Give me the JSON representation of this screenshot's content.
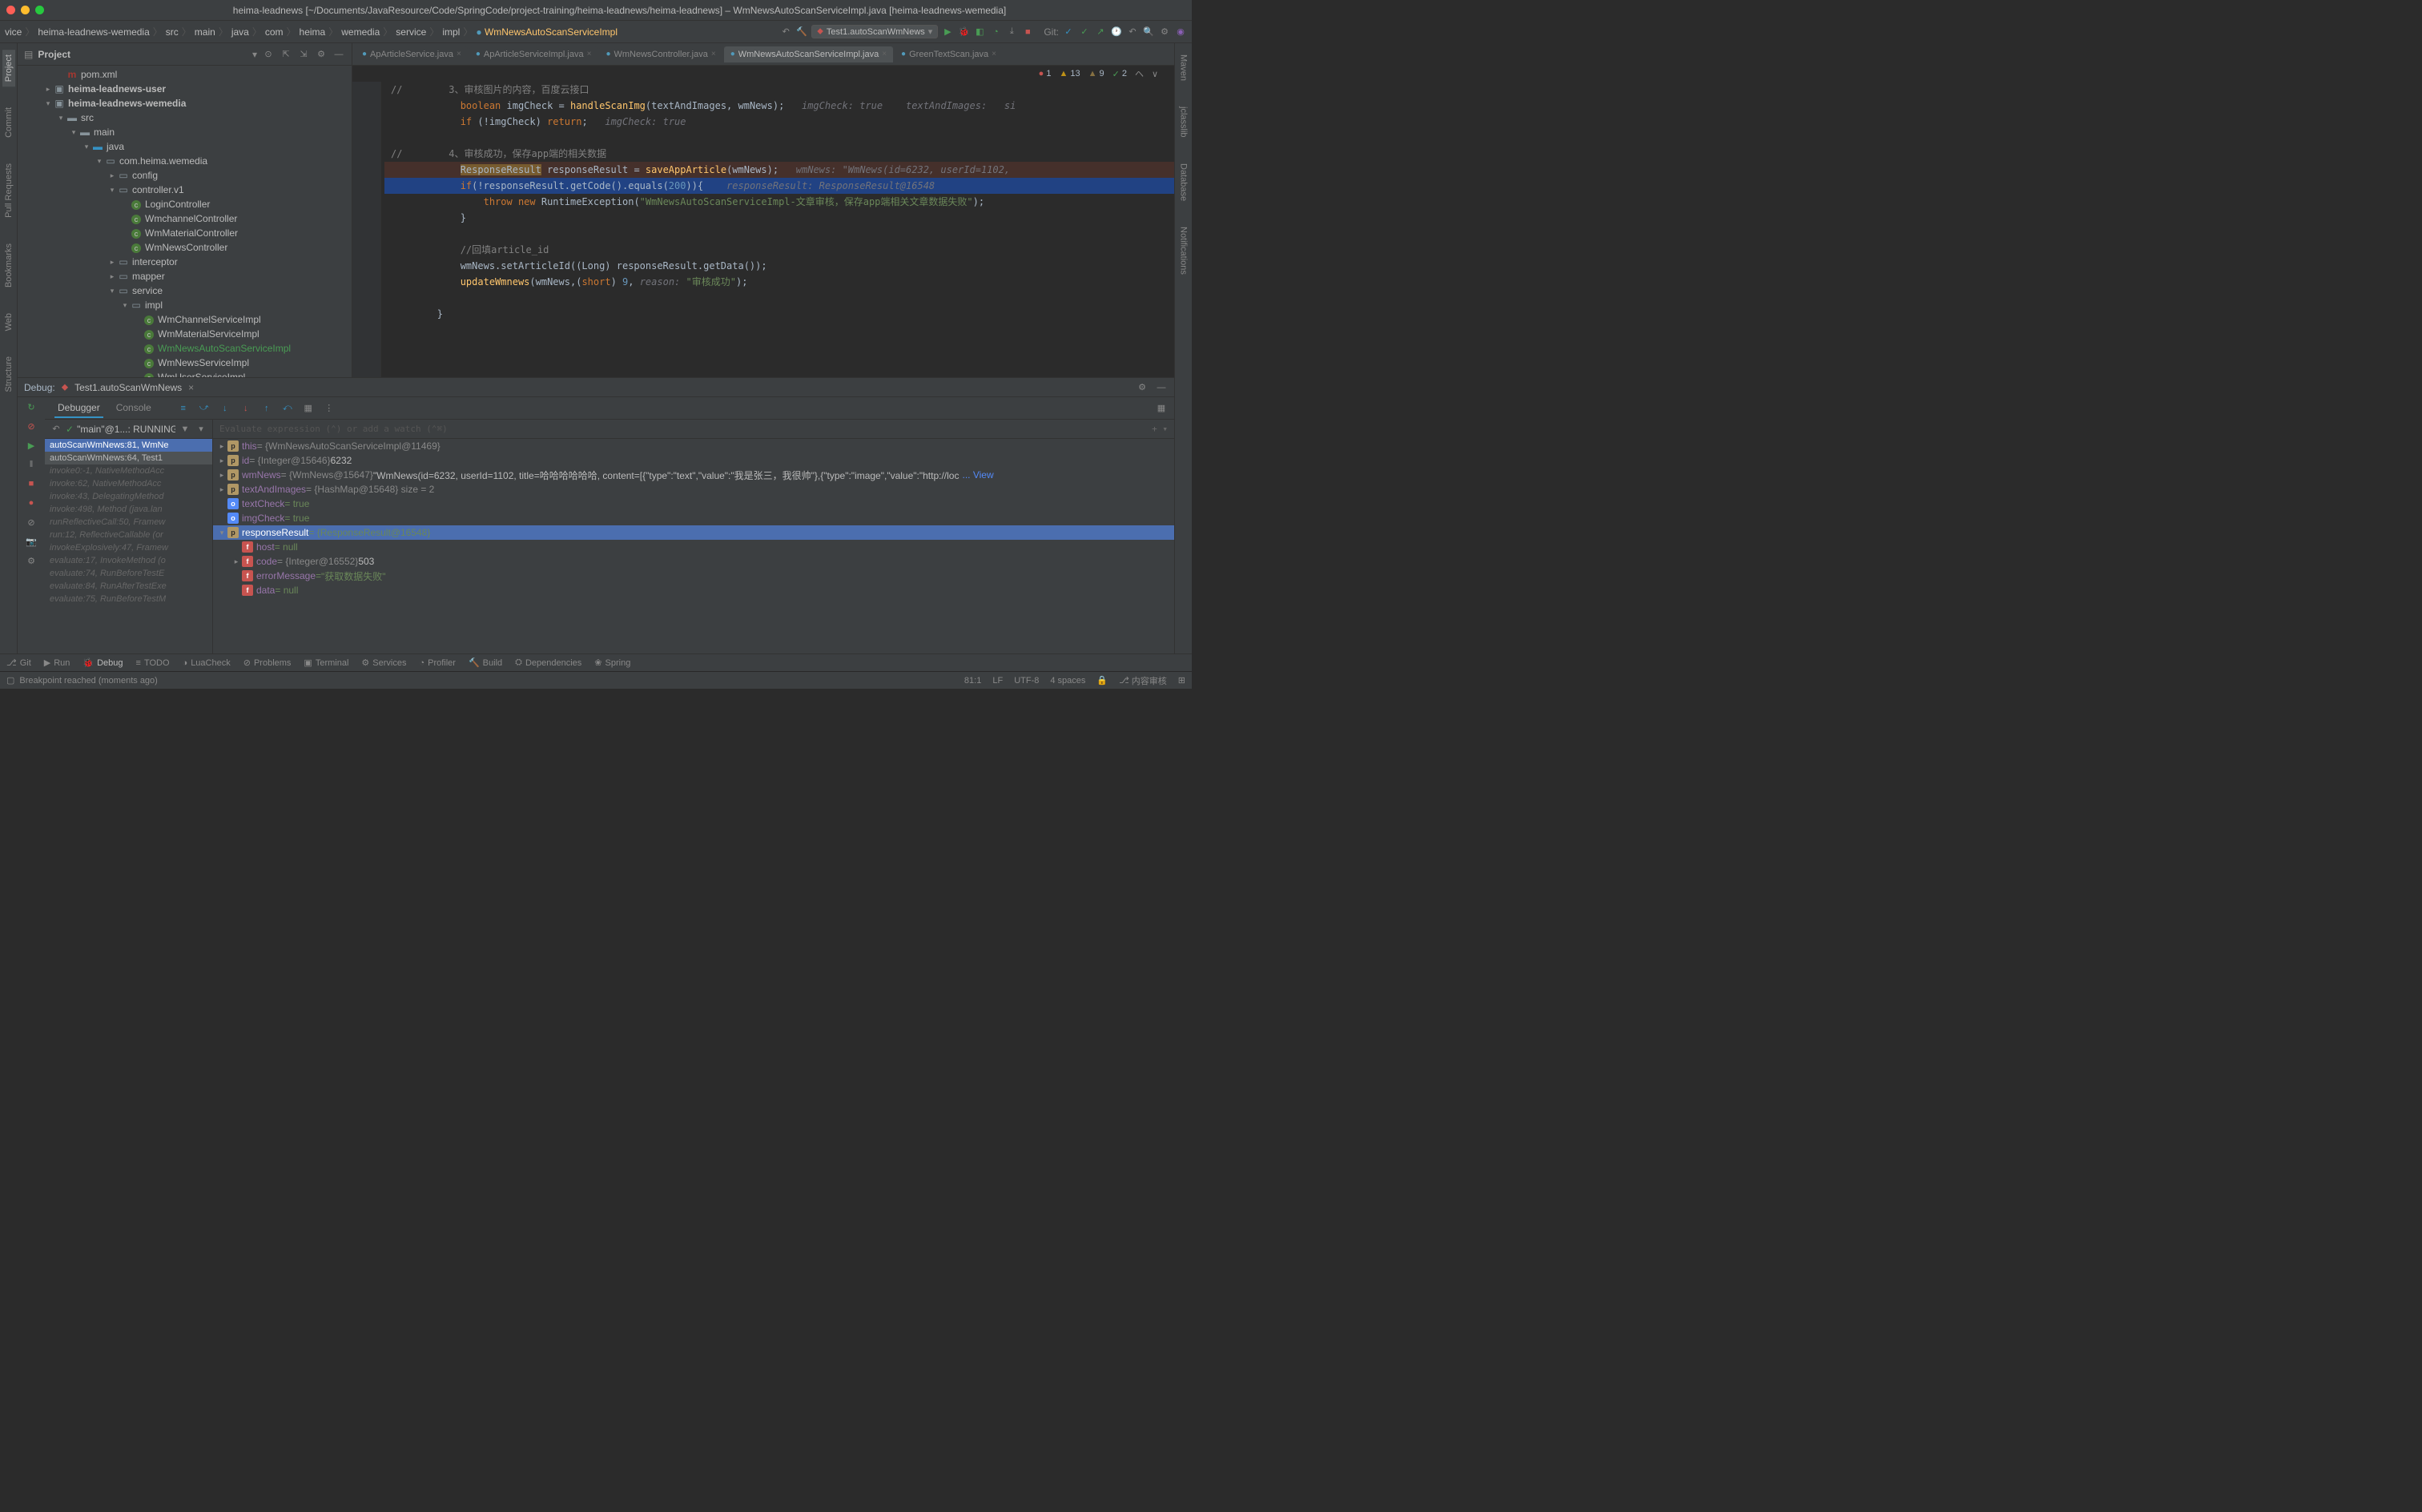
{
  "window": {
    "title": "heima-leadnews [~/Documents/JavaResource/Code/SpringCode/project-training/heima-leadnews/heima-leadnews] – WmNewsAutoScanServiceImpl.java [heima-leadnews-wemedia]"
  },
  "breadcrumb": [
    "vice",
    "heima-leadnews-wemedia",
    "src",
    "main",
    "java",
    "com",
    "heima",
    "wemedia",
    "service",
    "impl",
    "WmNewsAutoScanServiceImpl"
  ],
  "runConfig": "Test1.autoScanWmNews",
  "gitLabel": "Git:",
  "leftTabs": [
    "Project",
    "Commit",
    "Pull Requests",
    "Bookmarks",
    "Web",
    "Structure"
  ],
  "rightTabs": [
    "Maven",
    "jclasslib",
    "Database",
    "Notifications"
  ],
  "projectPanel": {
    "title": "Project"
  },
  "tree": [
    {
      "d": 3,
      "a": "",
      "i": "m",
      "t": "pom.xml"
    },
    {
      "d": 2,
      "a": ">",
      "i": "mod",
      "t": "heima-leadnews-user",
      "bold": true
    },
    {
      "d": 2,
      "a": "v",
      "i": "mod",
      "t": "heima-leadnews-wemedia",
      "bold": true
    },
    {
      "d": 3,
      "a": "v",
      "i": "fld",
      "t": "src"
    },
    {
      "d": 4,
      "a": "v",
      "i": "fld",
      "t": "main"
    },
    {
      "d": 5,
      "a": "v",
      "i": "fld",
      "t": "java",
      "blue": true
    },
    {
      "d": 6,
      "a": "v",
      "i": "pkg",
      "t": "com.heima.wemedia"
    },
    {
      "d": 7,
      "a": ">",
      "i": "pkg",
      "t": "config"
    },
    {
      "d": 7,
      "a": "v",
      "i": "pkg",
      "t": "controller.v1"
    },
    {
      "d": 8,
      "a": "",
      "i": "cls",
      "t": "LoginController"
    },
    {
      "d": 8,
      "a": "",
      "i": "cls",
      "t": "WmchannelController"
    },
    {
      "d": 8,
      "a": "",
      "i": "cls",
      "t": "WmMaterialController"
    },
    {
      "d": 8,
      "a": "",
      "i": "cls",
      "t": "WmNewsController"
    },
    {
      "d": 7,
      "a": ">",
      "i": "pkg",
      "t": "interceptor"
    },
    {
      "d": 7,
      "a": ">",
      "i": "pkg",
      "t": "mapper"
    },
    {
      "d": 7,
      "a": "v",
      "i": "pkg",
      "t": "service"
    },
    {
      "d": 8,
      "a": "v",
      "i": "pkg",
      "t": "impl"
    },
    {
      "d": 9,
      "a": "",
      "i": "cls",
      "t": "WmChannelServiceImpl"
    },
    {
      "d": 9,
      "a": "",
      "i": "cls",
      "t": "WmMaterialServiceImpl"
    },
    {
      "d": 9,
      "a": "",
      "i": "cls",
      "t": "WmNewsAutoScanServiceImpl",
      "hl": true
    },
    {
      "d": 9,
      "a": "",
      "i": "cls",
      "t": "WmNewsServiceImpl"
    },
    {
      "d": 9,
      "a": "",
      "i": "cls",
      "t": "WmUserServiceImpl"
    }
  ],
  "editorTabs": [
    {
      "label": "ApArticleService.java",
      "active": false
    },
    {
      "label": "ApArticleServiceImpl.java",
      "active": false
    },
    {
      "label": "WmNewsController.java",
      "active": false
    },
    {
      "label": "WmNewsAutoScanServiceImpl.java",
      "active": true
    },
    {
      "label": "GreenTextScan.java",
      "active": false
    }
  ],
  "inspections": {
    "err": "1",
    "warn": "13",
    "weak": "9",
    "ok": "2"
  },
  "code": [
    {
      "cls": "",
      "html": "<span class='cm'>//        3、审核图片的内容，百度云接口</span>"
    },
    {
      "cls": "",
      "html": "            <span class='kw'>boolean</span> imgCheck = <span class='mth'>handleScanImg</span>(textAndImages, wmNews);   <span class='hint'>imgCheck: true    textAndImages:   si</span>"
    },
    {
      "cls": "",
      "html": "            <span class='kw'>if</span> (!imgCheck) <span class='kw'>return</span>;   <span class='hint'>imgCheck: true</span>"
    },
    {
      "cls": "",
      "html": ""
    },
    {
      "cls": "",
      "html": "<span class='cm'>//        4、审核成功，保存app端的相关数据</span>"
    },
    {
      "cls": "hl-red",
      "html": "            <span style='background:#775b2f'>ResponseResult</span> responseResult = <span class='mth'>saveAppArticle</span>(wmNews);   <span class='hint'>wmNews: \"WmNews(id=6232, userId=1102,</span>"
    },
    {
      "cls": "hl-blue",
      "html": "            <span class='kw'>if</span>(!responseResult.getCode().equals(<span class='num'>200</span>)){    <span class='hint'>responseResult: ResponseResult@16548</span>"
    },
    {
      "cls": "",
      "html": "                <span class='kw'>throw new</span> RuntimeException(<span class='str'>\"WmNewsAutoScanServiceImpl-文章审核，保存app端相关文章数据失败\"</span>);"
    },
    {
      "cls": "",
      "html": "            }"
    },
    {
      "cls": "",
      "html": ""
    },
    {
      "cls": "",
      "html": "            <span class='cm'>//回填article_id</span>"
    },
    {
      "cls": "",
      "html": "            wmNews.setArticleId((Long) responseResult.getData());"
    },
    {
      "cls": "",
      "html": "            <span class='mth'>updateWmnews</span>(wmNews,(<span class='kw'>short</span>) <span class='num'>9</span>, <span class='hint'>reason:</span> <span class='str'>\"审核成功\"</span>);"
    },
    {
      "cls": "",
      "html": ""
    },
    {
      "cls": "",
      "html": "        }"
    }
  ],
  "debug": {
    "header": "Debug:",
    "config": "Test1.autoScanWmNews",
    "tabs": [
      "Debugger",
      "Console"
    ],
    "thread": "\"main\"@1...: RUNNING",
    "evalPlaceholder": "Evaluate expression (⌃) or add a watch (⌃⌘)",
    "frames": [
      {
        "t": "autoScanWmNews:81, WmNe",
        "cls": "active"
      },
      {
        "t": "autoScanWmNews:64, Test1",
        "cls": "second"
      },
      {
        "t": "invoke0:-1, NativeMethodAcc",
        "cls": "lib"
      },
      {
        "t": "invoke:62, NativeMethodAcc",
        "cls": "lib"
      },
      {
        "t": "invoke:43, DelegatingMethod",
        "cls": "lib"
      },
      {
        "t": "invoke:498, Method (java.lan",
        "cls": "lib"
      },
      {
        "t": "runReflectiveCall:50, Framew",
        "cls": "lib"
      },
      {
        "t": "run:12, ReflectiveCallable (or",
        "cls": "lib"
      },
      {
        "t": "invokeExplosively:47, Framew",
        "cls": "lib"
      },
      {
        "t": "evaluate:17, InvokeMethod (o",
        "cls": "lib"
      },
      {
        "t": "evaluate:74, RunBeforeTestE",
        "cls": "lib"
      },
      {
        "t": "evaluate:84, RunAfterTestExe",
        "cls": "lib"
      },
      {
        "t": "evaluate:75, RunBeforeTestM",
        "cls": "lib"
      }
    ],
    "vars": [
      {
        "d": 0,
        "a": ">",
        "i": "p",
        "n": "this",
        "v": " = {WmNewsAutoScanServiceImpl@11469}",
        "vc": "gray"
      },
      {
        "d": 0,
        "a": ">",
        "i": "p",
        "n": "id",
        "v": " = {Integer@15646} ",
        "vc": "gray",
        "extra": "6232"
      },
      {
        "d": 0,
        "a": ">",
        "i": "p",
        "n": "wmNews",
        "v": " = {WmNews@15647} ",
        "vc": "gray",
        "extra": "\"WmNews(id=6232, userId=1102, title=哈哈哈哈哈哈, content=[{\"type\":\"text\",\"value\":\"我是张三，我很帅\"},{\"type\":\"image\",\"value\":\"http://loc",
        "view": "... View"
      },
      {
        "d": 0,
        "a": ">",
        "i": "p",
        "n": "textAndImages",
        "v": " = {HashMap@15648}  size = 2",
        "vc": "gray"
      },
      {
        "d": 0,
        "a": "",
        "i": "o",
        "n": "textCheck",
        "v": " = true",
        "vc": ""
      },
      {
        "d": 0,
        "a": "",
        "i": "o",
        "n": "imgCheck",
        "v": " = true",
        "vc": ""
      },
      {
        "d": 0,
        "a": "v",
        "i": "p",
        "n": "responseResult",
        "v": " = {ResponseResult@16548}",
        "vc": "",
        "sel": true
      },
      {
        "d": 1,
        "a": "",
        "i": "f",
        "n": "host",
        "v": " = null",
        "vc": ""
      },
      {
        "d": 1,
        "a": ">",
        "i": "f",
        "n": "code",
        "v": " = {Integer@16552} ",
        "vc": "gray",
        "extra": "503"
      },
      {
        "d": 1,
        "a": "",
        "i": "f",
        "n": "errorMessage",
        "v": " = ",
        "vc": "",
        "extra": "\"获取数据失败\"",
        "extraCls": "str"
      },
      {
        "d": 1,
        "a": "",
        "i": "f",
        "n": "data",
        "v": " = null",
        "vc": ""
      }
    ]
  },
  "bottomBar": [
    {
      "i": "⎇",
      "t": "Git"
    },
    {
      "i": "▶",
      "t": "Run"
    },
    {
      "i": "🐞",
      "t": "Debug",
      "active": true
    },
    {
      "i": "≡",
      "t": "TODO"
    },
    {
      "i": "◑",
      "t": "LuaCheck"
    },
    {
      "i": "⊘",
      "t": "Problems"
    },
    {
      "i": "▣",
      "t": "Terminal"
    },
    {
      "i": "⚙",
      "t": "Services"
    },
    {
      "i": "◔",
      "t": "Profiler"
    },
    {
      "i": "🔨",
      "t": "Build"
    },
    {
      "i": "⛭",
      "t": "Dependencies"
    },
    {
      "i": "❀",
      "t": "Spring"
    }
  ],
  "status": {
    "msg": "Breakpoint reached (moments ago)",
    "pos": "81:1",
    "eol": "LF",
    "enc": "UTF-8",
    "indent": "4 spaces",
    "branch": "内容审核",
    "lock": "⎆"
  }
}
